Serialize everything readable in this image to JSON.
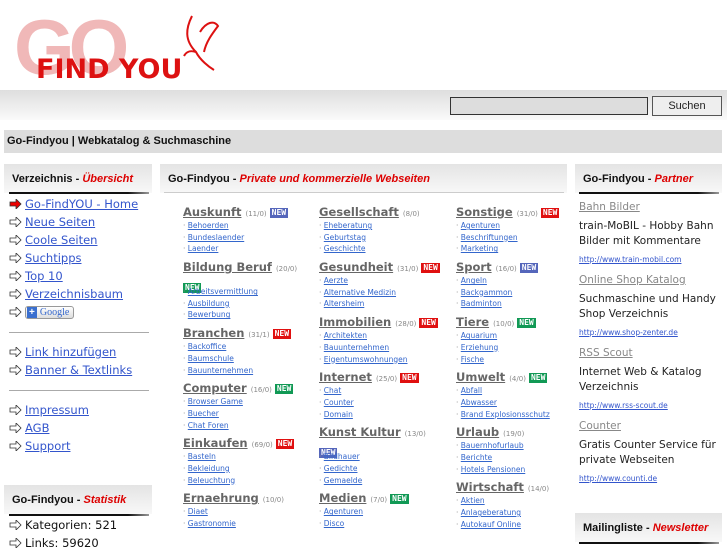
{
  "logo": {
    "text_go": "GO",
    "text_findyou": "FIND YOU"
  },
  "search": {
    "value": "",
    "button": "Suchen"
  },
  "page_title": "Go-Findyou | Webkatalog & Suchmaschine",
  "left": {
    "header": {
      "a": "Verzeichnis - ",
      "b": "Übersicht"
    },
    "nav": [
      "Go-FindYOU - Home",
      "Neue Seiten",
      "Coole Seiten",
      "Suchtipps",
      "Top 10",
      "Verzeichnisbaum"
    ],
    "google_button": "Google",
    "nav2": [
      "Link hinzufügen",
      "Banner & Textlinks"
    ],
    "nav3": [
      "Impressum",
      "AGB",
      "Support"
    ],
    "stats_header": {
      "a": "Go-Findyou - ",
      "b": "Statistik"
    },
    "stats": [
      "Kategorien:  521",
      "Links:  59620"
    ]
  },
  "main": {
    "header": {
      "a": "Go-Findyou - ",
      "b": "Private und kommerzielle Webseiten"
    },
    "new_label": "NEW",
    "columns": [
      [
        {
          "name": "Auskunft",
          "count": "(11/0)",
          "new": "blue",
          "links": [
            "Behoerden",
            "Bundeslaender",
            "Laender"
          ]
        },
        {
          "name": "Bildung Beruf",
          "count": "(20/0)",
          "new": "green",
          "wrap": true,
          "links": [
            "Arbeitsvermittlung",
            "Ausbildung",
            "Bewerbung"
          ]
        },
        {
          "name": "Branchen",
          "count": "(31/1)",
          "new": "red",
          "links": [
            "Backoffice",
            "Baumschule",
            "Bauunternehmen"
          ]
        },
        {
          "name": "Computer",
          "count": "(16/0)",
          "new": "green",
          "links": [
            "Browser Game",
            "Buecher",
            "Chat Foren"
          ]
        },
        {
          "name": "Einkaufen",
          "count": "(69/0)",
          "new": "red",
          "links": [
            "Basteln",
            "Bekleidung",
            "Beleuchtung"
          ]
        },
        {
          "name": "Ernaehrung",
          "count": "(10/0)",
          "new": null,
          "links": [
            "Diaet",
            "Gastronomie"
          ]
        }
      ],
      [
        {
          "name": "Gesellschaft",
          "count": "(8/0)",
          "new": null,
          "links": [
            "Eheberatung",
            "Geburtstag",
            "Geschichte"
          ]
        },
        {
          "name": "Gesundheit",
          "count": "(31/0)",
          "new": "red",
          "links": [
            "Aerzte",
            "Alternative Medizin",
            "Altersheim"
          ]
        },
        {
          "name": "Immobilien",
          "count": "(28/0)",
          "new": "red",
          "links": [
            "Architekten",
            "Bauunternehmen",
            "Eigentumswohnungen"
          ]
        },
        {
          "name": "Internet",
          "count": "(25/0)",
          "new": "red",
          "links": [
            "Chat",
            "Counter",
            "Domain"
          ]
        },
        {
          "name": "Kunst Kultur",
          "count": "(13/0)",
          "new": "blue",
          "wrap": true,
          "links": [
            "Bildhauer",
            "Gedichte",
            "Gemaelde"
          ]
        },
        {
          "name": "Medien",
          "count": "(7/0)",
          "new": "green",
          "links": [
            "Agenturen",
            "Disco"
          ]
        }
      ],
      [
        {
          "name": "Sonstige",
          "count": "(31/0)",
          "new": "red",
          "links": [
            "Agenturen",
            "Beschriftungen",
            "Marketing"
          ]
        },
        {
          "name": "Sport",
          "count": "(16/0)",
          "new": "blue",
          "links": [
            "Angeln",
            "Backgammon",
            "Badminton"
          ]
        },
        {
          "name": "Tiere",
          "count": "(10/0)",
          "new": "green",
          "links": [
            "Aquarium",
            "Erziehung",
            "Fische"
          ]
        },
        {
          "name": "Umwelt",
          "count": "(4/0)",
          "new": "green",
          "links": [
            "Abfall",
            "Abwasser",
            "Brand Explosionsschutz"
          ]
        },
        {
          "name": "Urlaub",
          "count": "(19/0)",
          "new": null,
          "links": [
            "Bauernhofurlaub",
            "Berichte",
            "Hotels Pensionen"
          ]
        },
        {
          "name": "Wirtschaft",
          "count": "(14/0)",
          "new": null,
          "links": [
            "Aktien",
            "Anlageberatung",
            "Autokauf Online"
          ]
        }
      ]
    ]
  },
  "right": {
    "header": {
      "a": "Go-Findyou - ",
      "b": "Partner"
    },
    "partners": [
      {
        "title": "Bahn Bilder",
        "desc": "train-MoBIL - Hobby Bahn Bilder mit Kommentare",
        "url": "http://www.train-mobil.com"
      },
      {
        "title": "Online Shop Katalog",
        "desc": "Suchmaschine und Handy Shop Verzeichnis",
        "url": "http://www.shop-zenter.de"
      },
      {
        "title": "RSS Scout",
        "desc": "Internet Web & Katalog Verzeichnis",
        "url": "http://www.rss-scout.de"
      },
      {
        "title": "Counter",
        "desc": "Gratis Counter Service für private Webseiten",
        "url": "http://www.counti.de"
      }
    ],
    "mail_header": {
      "a": "Mailingliste - ",
      "b": "Newsletter"
    }
  },
  "colors": {
    "new_red": "#e01010",
    "new_green": "#119955",
    "new_blue": "#5566bb",
    "accent": "#dd0000"
  }
}
